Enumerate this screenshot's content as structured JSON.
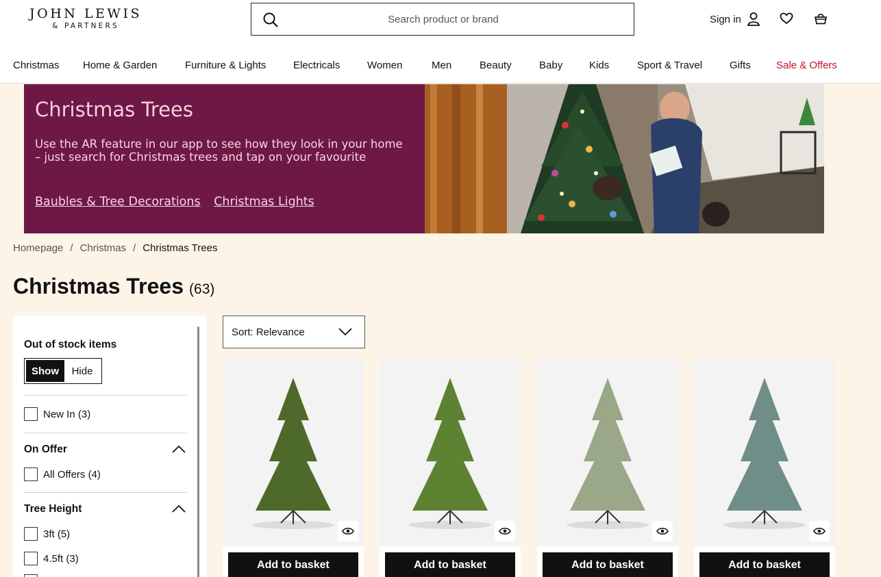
{
  "header": {
    "logo_line1": "JOHN LEWIS",
    "logo_line2": "& PARTNERS",
    "search_placeholder": "Search product or brand",
    "sign_in": "Sign in"
  },
  "nav": [
    "Christmas",
    "Home & Garden",
    "Furniture & Lights",
    "Electricals",
    "Women",
    "Men",
    "Beauty",
    "Baby",
    "Kids",
    "Sport & Travel",
    "Gifts",
    "Sale & Offers"
  ],
  "hero": {
    "title": "Christmas Trees",
    "text": "Use the AR feature in our app to see how they look in your home – just search for Christmas trees and tap on your favourite",
    "link1": "Baubles & Tree Decorations",
    "link2": "Christmas Lights",
    "colors": {
      "panel": "#6e1845",
      "text": "#f7d6e1"
    }
  },
  "breadcrumb": [
    "Homepage",
    "Christmas",
    "Christmas Trees"
  ],
  "page": {
    "title": "Christmas Trees",
    "count": "(63)"
  },
  "filters": {
    "out_of_stock_title": "Out of stock items",
    "show": "Show",
    "hide": "Hide",
    "new_in": "New In (3)",
    "on_offer_title": "On Offer",
    "all_offers": "All Offers (4)",
    "tree_height_title": "Tree Height",
    "height_3ft": "3ft (5)",
    "height_45ft": "4.5ft (3)"
  },
  "sort": {
    "label": "Sort: Relevance"
  },
  "products": [
    {
      "button": "Add to basket",
      "tree_color": "#4d6a2a"
    },
    {
      "button": "Add to basket",
      "tree_color": "#5d8232"
    },
    {
      "button": "Add to basket",
      "tree_color": "#9aa889"
    },
    {
      "button": "Add to basket",
      "tree_color": "#6f8e88"
    }
  ]
}
